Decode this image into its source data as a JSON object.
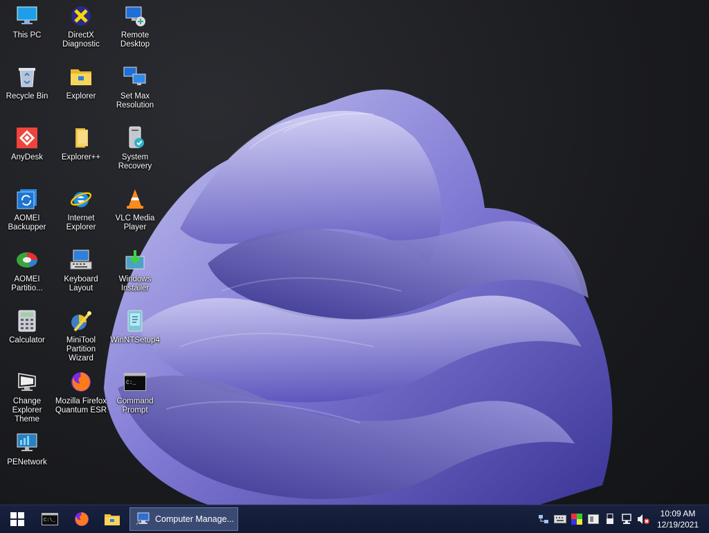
{
  "desktop": {
    "icons": [
      {
        "label": "This PC",
        "icon": "monitor-icon"
      },
      {
        "label": "DirectX\nDiagnostic",
        "icon": "directx-icon"
      },
      {
        "label": "Remote\nDesktop",
        "icon": "remote-desktop-icon"
      },
      {
        "label": "Recycle Bin",
        "icon": "recycle-bin-icon"
      },
      {
        "label": "Explorer",
        "icon": "folder-icon"
      },
      {
        "label": "Set Max\nResolution",
        "icon": "monitors-icon"
      },
      {
        "label": "AnyDesk",
        "icon": "anydesk-icon"
      },
      {
        "label": "Explorer++",
        "icon": "folder-plus-icon"
      },
      {
        "label": "System\nRecovery",
        "icon": "system-recovery-icon"
      },
      {
        "label": "AOMEI\nBackupper",
        "icon": "aomei-backupper-icon"
      },
      {
        "label": "Internet\nExplorer",
        "icon": "internet-explorer-icon"
      },
      {
        "label": "VLC Media\nPlayer",
        "icon": "vlc-cone-icon"
      },
      {
        "label": "AOMEI\nPartitio...",
        "icon": "aomei-partition-icon"
      },
      {
        "label": "Keyboard\nLayout",
        "icon": "keyboard-layout-icon"
      },
      {
        "label": "Windows\nInstaller",
        "icon": "windows-installer-icon"
      },
      {
        "label": "Calculator",
        "icon": "calculator-icon"
      },
      {
        "label": "MiniTool\nPartition Wizard",
        "icon": "minitool-wizard-icon"
      },
      {
        "label": "WinNTSetup4",
        "icon": "winntsetup-icon"
      },
      {
        "label": "Change\nExplorer Theme",
        "icon": "theme-monitor-icon"
      },
      {
        "label": "Mozilla Firefox\nQuantum ESR",
        "icon": "firefox-icon"
      },
      {
        "label": "Command\nPrompt",
        "icon": "command-prompt-icon"
      },
      {
        "label": "PENetwork",
        "icon": "penetwork-icon"
      }
    ]
  },
  "taskbar": {
    "pinned": [
      {
        "icon": "windows-start-icon"
      },
      {
        "icon": "command-prompt-icon"
      },
      {
        "icon": "firefox-icon"
      },
      {
        "icon": "folder-icon"
      }
    ],
    "active_task": {
      "title": "Computer Manage...",
      "icon": "computer-management-icon"
    },
    "tray": [
      "network-icon",
      "keyboard-icon",
      "color-icon",
      "display-icon",
      "usb-icon",
      "network-monitor-icon",
      "volume-muted-icon"
    ],
    "clock": {
      "time": "10:09 AM",
      "date": "12/19/2021"
    }
  },
  "colors": {
    "taskbar": "#18223f",
    "accent": "#5b5fc7"
  }
}
